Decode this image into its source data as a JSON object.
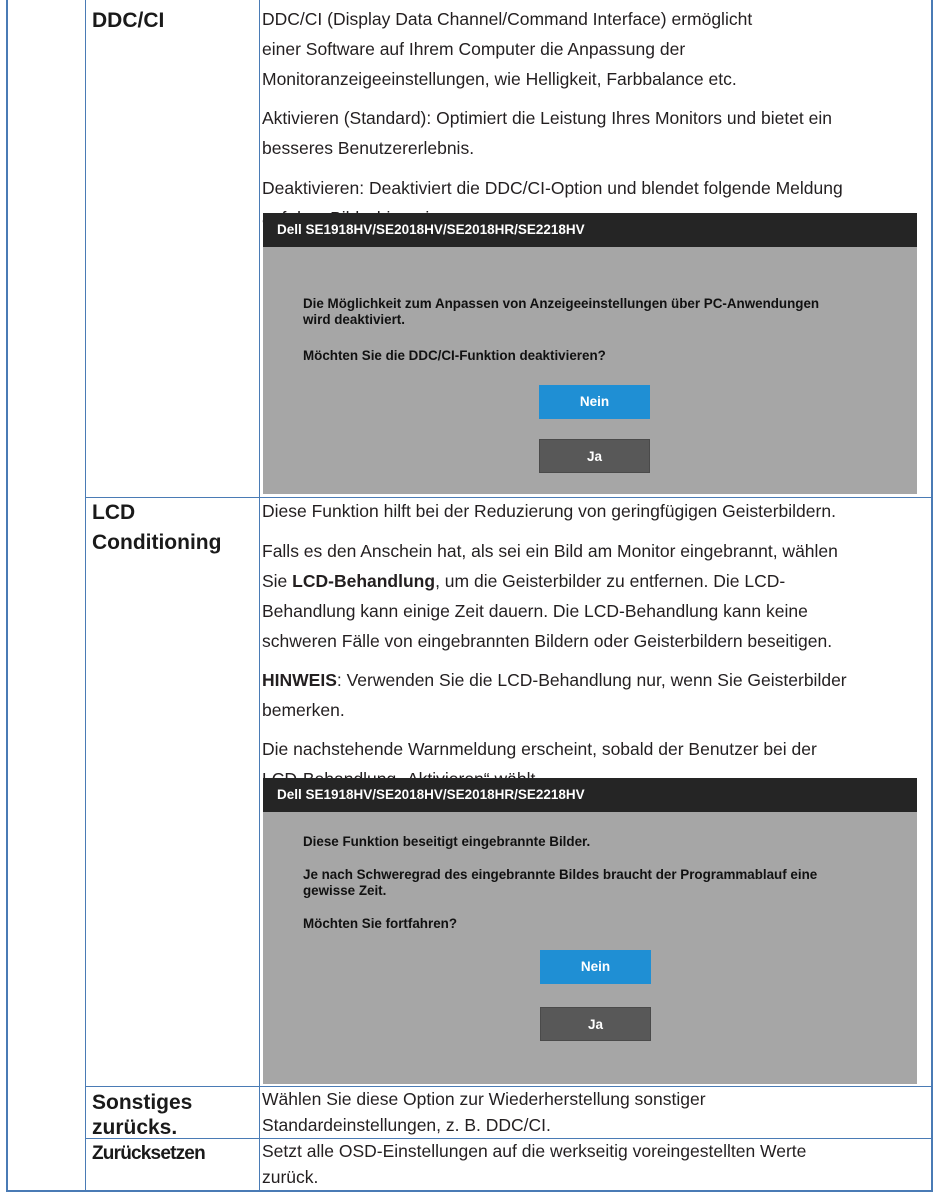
{
  "rows": {
    "ddc": {
      "label": "DDC/CI",
      "p1": "DDC/CI (Display Data Channel/Command Interface) ermöglicht",
      "p1b": "einer Software auf Ihrem Computer die Anpassung der",
      "p1c": "Monitoranzeigeeinstellungen, wie Helligkeit, Farbbalance etc.",
      "p2a": "Aktivieren (Standard): Optimiert die Leistung Ihres Monitors und bietet ein",
      "p2b": "besseres Benutzererlebnis.",
      "p3a": "Deaktivieren: Deaktiviert die DDC/CI-Option und blendet folgende Meldung",
      "p3b": "auf dem Bildschirm ein.",
      "dialog": {
        "title": "Dell SE1918HV/SE2018HV/SE2018HR/SE2218HV",
        "msg1a": "Die Möglichkeit zum Anpassen von Anzeigeeinstellungen über PC-Anwendungen",
        "msg1b": "wird deaktiviert.",
        "msg2": "Möchten Sie die DDC/CI-Funktion deaktivieren?",
        "nein": "Nein",
        "ja": "Ja"
      }
    },
    "lcd": {
      "label1": "LCD",
      "label2": "Conditioning",
      "p1": "Diese Funktion hilft bei der Reduzierung von geringfügigen Geisterbildern.",
      "p2a": "Falls es den Anschein hat, als sei ein Bild am Monitor eingebrannt, wählen",
      "p2b_pre": "Sie ",
      "p2b_bold": "LCD-Behandlung",
      "p2b_post": ", um die Geisterbilder zu entfernen. Die LCD-",
      "p2c": "Behandlung kann einige Zeit dauern. Die LCD-Behandlung kann keine",
      "p2d": "schweren Fälle von eingebrannten Bildern oder Geisterbildern beseitigen.",
      "p3_bold": "HINWEIS",
      "p3a_post": ": Verwenden Sie die LCD-Behandlung nur, wenn Sie Geisterbilder",
      "p3b": "bemerken.",
      "p4a": "Die nachstehende Warnmeldung erscheint, sobald der Benutzer bei der",
      "p4b": "LCD-Behandlung „Aktivieren“ wählt.",
      "dialog": {
        "title": "Dell SE1918HV/SE2018HV/SE2018HR/SE2218HV",
        "msg1": "Diese Funktion beseitigt eingebrannte Bilder.",
        "msg2a": "Je nach Schweregrad des eingebrannte Bildes braucht der Programmablauf eine",
        "msg2b": "gewisse Zeit.",
        "msg3": "Möchten Sie fortfahren?",
        "nein": "Nein",
        "ja": "Ja"
      }
    },
    "sonstiges": {
      "label1": "Sonstiges",
      "label2": "zurücks.",
      "p1a": "Wählen Sie diese Option zur Wiederherstellung sonstiger",
      "p1b": "Standardeinstellungen, z. B. DDC/CI."
    },
    "reset": {
      "label": "Zurücksetzen",
      "p1a": "Setzt alle OSD-Einstellungen auf die werkseitig voreingestellten Werte",
      "p1b": "zurück."
    }
  },
  "colors": {
    "border": "#4a7bb5",
    "dialog_bg": "#a6a6a6",
    "dialog_bar": "#252525",
    "nein_button": "#1f8fd4",
    "ja_button": "#585858"
  }
}
